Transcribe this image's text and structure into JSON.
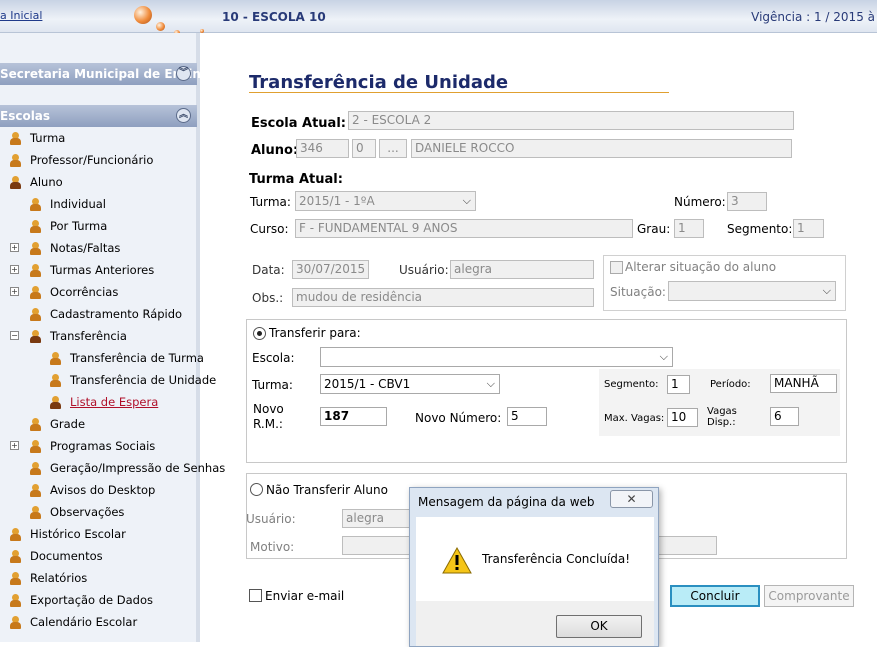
{
  "header": {
    "home_link": "a Inicial",
    "school": "10 - ESCOLA 10",
    "vigencia": "Vigência : 1 / 2015 à"
  },
  "sidebar": {
    "section1": "Secretaria Municipal de Ensino",
    "section2": "Escolas",
    "items": [
      {
        "label": "Turma"
      },
      {
        "label": "Professor/Funcionário"
      },
      {
        "label": "Aluno"
      },
      {
        "label": "Individual"
      },
      {
        "label": "Por Turma"
      },
      {
        "label": "Notas/Faltas"
      },
      {
        "label": "Turmas Anteriores"
      },
      {
        "label": "Ocorrências"
      },
      {
        "label": "Cadastramento Rápido"
      },
      {
        "label": "Transferência"
      },
      {
        "label": "Transferência de Turma"
      },
      {
        "label": "Transferência de Unidade"
      },
      {
        "label": "Lista de Espera"
      },
      {
        "label": "Grade"
      },
      {
        "label": "Programas Sociais"
      },
      {
        "label": "Geração/Impressão de Senhas"
      },
      {
        "label": "Avisos do Desktop"
      },
      {
        "label": "Observações"
      },
      {
        "label": "Histórico Escolar"
      },
      {
        "label": "Documentos"
      },
      {
        "label": "Relatórios"
      },
      {
        "label": "Exportação de Dados"
      },
      {
        "label": "Calendário Escolar"
      }
    ]
  },
  "form": {
    "title": "Transferência de Unidade",
    "escola_atual_label": "Escola Atual:",
    "escola_atual": "2 - ESCOLA 2",
    "aluno_label": "Aluno:",
    "aluno_id": "346",
    "aluno_digit": "0",
    "aluno_btn": "...",
    "aluno_nome": "DANIELE ROCCO",
    "turma_atual_label": "Turma Atual:",
    "turma_label": "Turma:",
    "turma": "2015/1 - 1ºA",
    "numero_label": "Número:",
    "numero": "3",
    "curso_label": "Curso:",
    "curso": "F - FUNDAMENTAL 9 ANOS",
    "grau_label": "Grau:",
    "grau": "1",
    "segmento_label": "Segmento:",
    "segmento": "1",
    "data_label": "Data:",
    "data": "30/07/2015",
    "usuario_label": "Usuário:",
    "usuario": "alegra",
    "obs_label": "Obs.:",
    "obs": "mudou de residência",
    "alterar_label": "Alterar situação do aluno",
    "situacao_label": "Situação:",
    "situacao": ""
  },
  "transfer": {
    "radio_label": "Transferir para:",
    "escola_label": "Escola:",
    "escola": "",
    "turma_label": "Turma:",
    "turma": "2015/1 - CBV1",
    "novo_rm_label": "Novo R.M.:",
    "novo_rm": "187",
    "novo_numero_label": "Novo Número:",
    "novo_numero": "5",
    "segmento_label": "Segmento:",
    "segmento": "1",
    "periodo_label": "Período:",
    "periodo": "MANHÃ",
    "max_vagas_label": "Max. Vagas:",
    "max_vagas": "10",
    "vagas_disp_label": "Vagas Disp.:",
    "vagas_disp": "6"
  },
  "no_transfer": {
    "radio_label": "Não Transferir Aluno",
    "usuario_label": "Usuário:",
    "usuario": "alegra",
    "motivo_label": "Motivo:",
    "motivo": ""
  },
  "footer": {
    "email_label": "Enviar e-mail",
    "concluir": "Concluir",
    "comprovante": "Comprovante"
  },
  "dialog": {
    "title": "Mensagem da página da web",
    "close": "✕",
    "message": "Transferência Concluída!",
    "ok": "OK"
  }
}
